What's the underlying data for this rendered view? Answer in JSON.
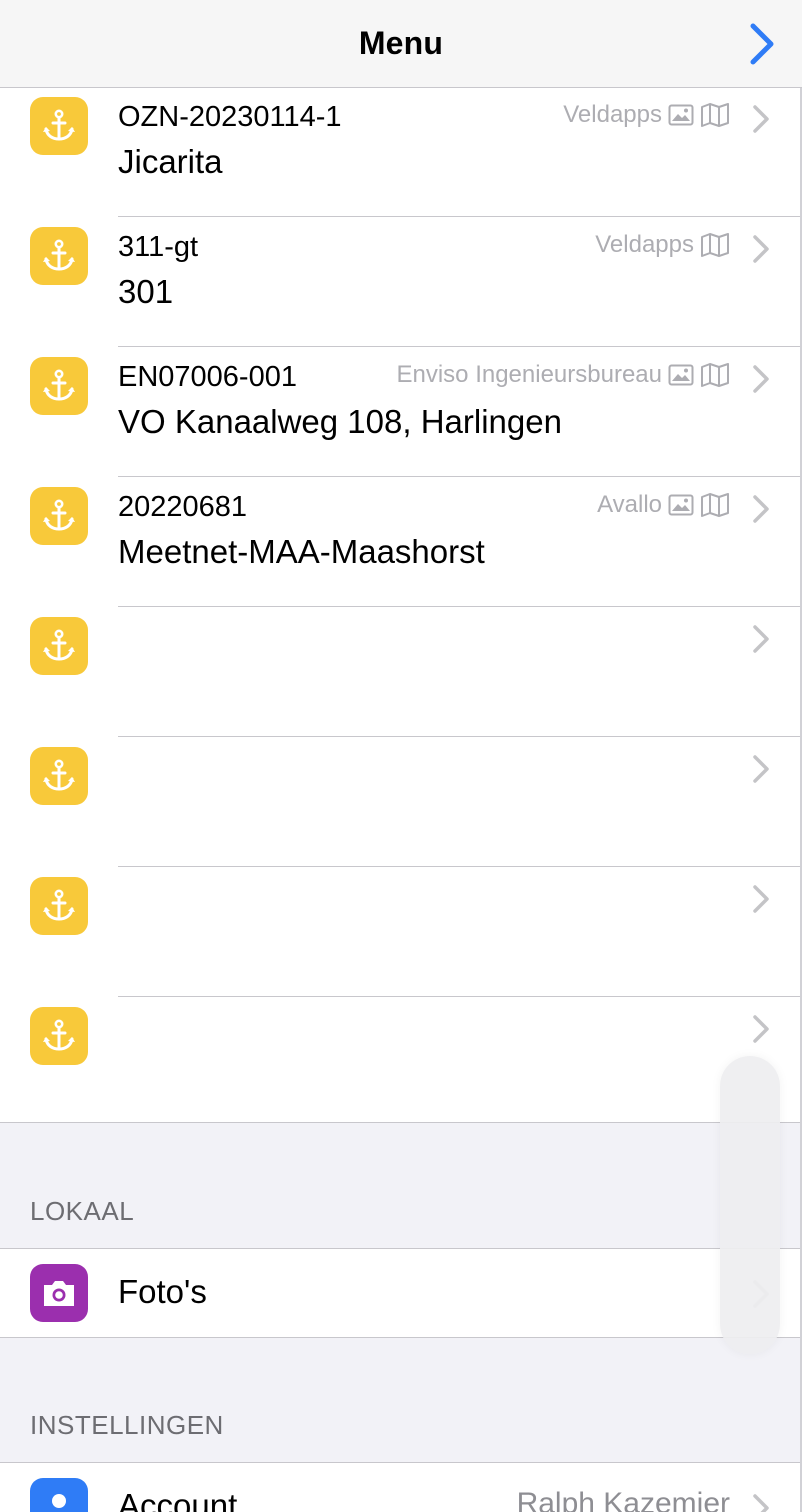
{
  "navbar": {
    "title": "Menu",
    "forward_icon": "chevron-right-icon",
    "accent_color": "#2f7cf6"
  },
  "projects": [
    {
      "code": "OZN-20230114-1",
      "name": "Jicarita",
      "org": "Veldapps",
      "has_photo": true,
      "has_map": true
    },
    {
      "code": "311-gt",
      "name": "301",
      "org": "Veldapps",
      "has_photo": false,
      "has_map": true
    },
    {
      "code": "EN07006-001",
      "name": "VO Kanaalweg 108, Harlingen",
      "org": "Enviso Ingenieursbureau",
      "has_photo": true,
      "has_map": true
    },
    {
      "code": "20220681",
      "name": "Meetnet-MAA-Maashorst",
      "org": "Avallo",
      "has_photo": true,
      "has_map": true
    },
    {
      "code": "",
      "name": "",
      "org": "",
      "has_photo": false,
      "has_map": false
    },
    {
      "code": "",
      "name": "",
      "org": "",
      "has_photo": false,
      "has_map": false
    },
    {
      "code": "",
      "name": "",
      "org": "",
      "has_photo": false,
      "has_map": false
    },
    {
      "code": "",
      "name": "",
      "org": "",
      "has_photo": false,
      "has_map": false
    }
  ],
  "project_icon": "anchor-icon",
  "project_icon_color": "#f8c93a",
  "sections": {
    "lokaal": {
      "header": "LOKAAL",
      "items": [
        {
          "label": "Foto's",
          "icon": "camera-icon",
          "color": "#9b2fae"
        }
      ]
    },
    "instellingen": {
      "header": "INSTELLINGEN",
      "items": [
        {
          "label": "Account",
          "value": "Ralph Kazemier",
          "icon": "person-icon",
          "color": "#2f7cf6"
        }
      ]
    }
  }
}
